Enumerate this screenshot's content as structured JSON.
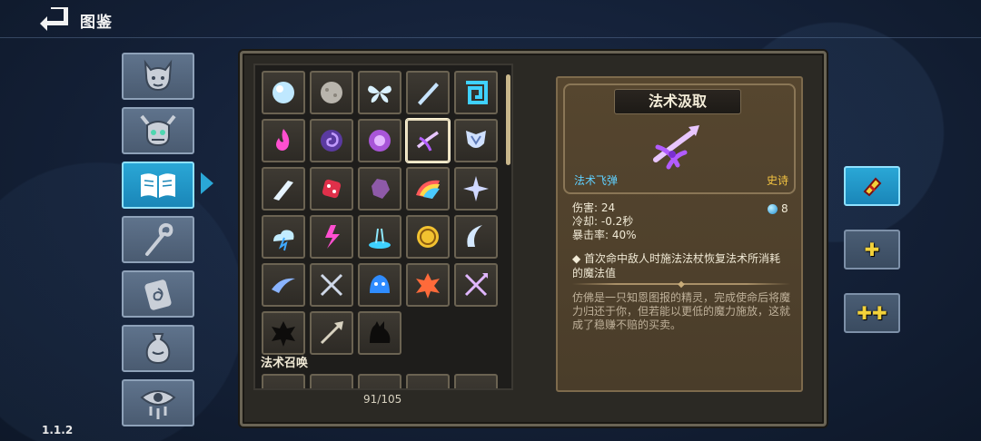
{
  "header": {
    "title": "图鉴"
  },
  "version": "1.1.2",
  "sidebar": {
    "tabs": [
      {
        "icon": "demon-face-icon"
      },
      {
        "icon": "horned-skull-icon"
      },
      {
        "icon": "open-book-icon",
        "active": true
      },
      {
        "icon": "staff-icon"
      },
      {
        "icon": "spell-card-icon"
      },
      {
        "icon": "potion-bag-icon"
      },
      {
        "icon": "eye-icon"
      }
    ]
  },
  "grid": {
    "slots": [
      "frost-orb-icon",
      "stone-ball-icon",
      "butterfly-icon",
      "ice-shard-icon",
      "spiral-rune-icon",
      "pink-flame-icon",
      "vortex-icon",
      "purple-orb-icon",
      "spell-siphon-icon",
      "shield-crest-icon",
      "ice-spike-icon",
      "red-dice-icon",
      "purple-rock-icon",
      "rainbow-fan-icon",
      "star-sparkle-icon",
      "lightning-cloud-icon",
      "pink-lightning-icon",
      "blue-geyser-icon",
      "gold-coin-icon",
      "crescent-blade-icon",
      "wind-slash-icon",
      "crossed-blades-icon",
      "blue-slime-icon",
      "fire-burst-icon",
      "crossed-arrows-icon",
      "shadow-splat-icon",
      "arrow-icon",
      "shadow-cat-icon"
    ],
    "selected_index": 8,
    "section_title": "法术召唤",
    "count": "91/105"
  },
  "detail": {
    "name": "法术汲取",
    "icon": "spell-siphon-icon",
    "type": "法术飞弹",
    "rarity": "史诗",
    "stats": [
      {
        "label": "伤害: 24"
      },
      {
        "label": "冷却: -0.2秒"
      },
      {
        "label": "暴击率: 40%"
      }
    ],
    "mana": "8",
    "effect": "◆ 首次命中敌人时施法法杖恢复法术所消耗的魔法值",
    "lore": "仿佛是一只知恩图报的精灵，完成使命后将魔力归还于你，但若能以更低的魔力施放，这就成了稳赚不赔的买卖。"
  },
  "side_buttons": [
    {
      "icon": "eraser-icon",
      "active": true
    },
    {
      "icon": "plus-icon",
      "label": "✚"
    },
    {
      "icon": "double-plus-icon",
      "label": "✚✚"
    }
  ],
  "colors": {
    "accent": "#2aa7d6",
    "rarity_epic": "#f5c542",
    "type_blue": "#5fd0ff"
  }
}
